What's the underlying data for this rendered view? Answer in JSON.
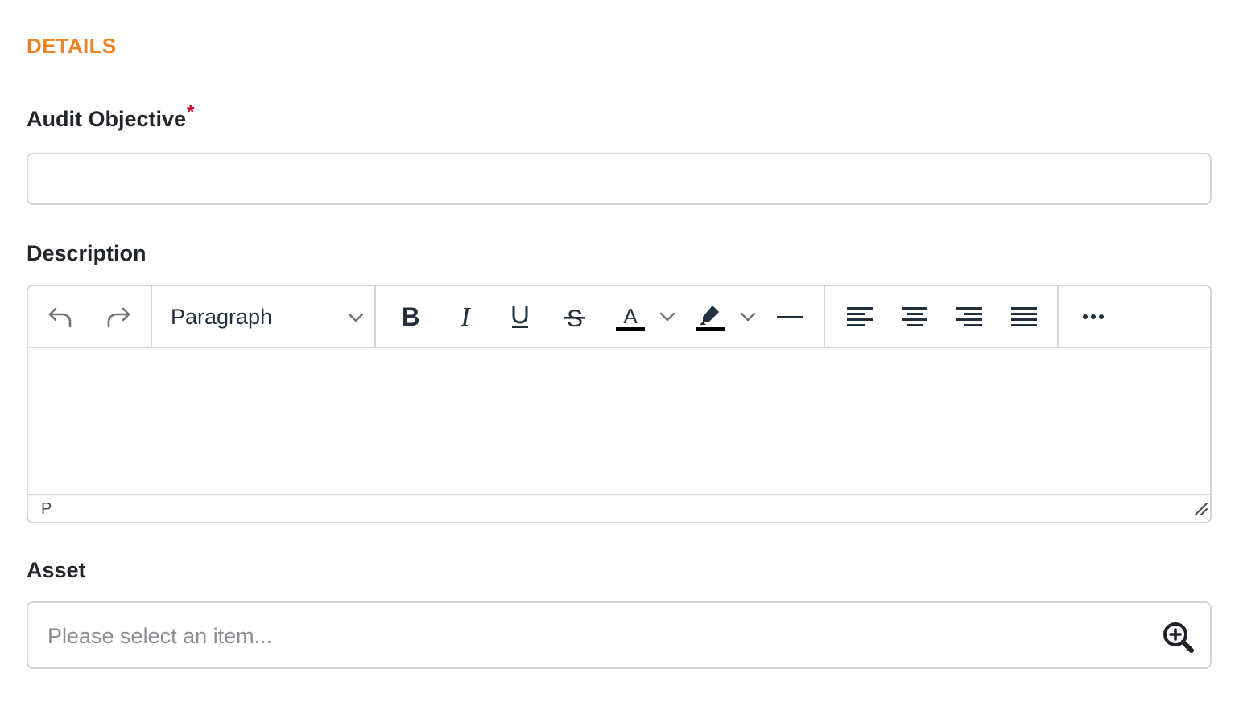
{
  "section": {
    "title": "DETAILS",
    "accent_color": "#ef8222"
  },
  "fields": {
    "audit_objective": {
      "label": "Audit Objective",
      "required_mark": "*",
      "value": ""
    },
    "description": {
      "label": "Description",
      "editor": {
        "toolbar": {
          "undo_icon": "undo-icon",
          "redo_icon": "redo-icon",
          "block_format": "Paragraph",
          "bold_icon": "bold-icon",
          "italic_icon": "italic-icon",
          "underline_icon": "underline-icon",
          "strikethrough_icon": "strikethrough-icon",
          "text_color_icon": "text-color-icon",
          "highlight_icon": "highlight-icon",
          "horizontal_rule_icon": "horizontal-rule-icon",
          "align_left_icon": "align-left-icon",
          "align_center_icon": "align-center-icon",
          "align_right_icon": "align-right-icon",
          "align_justify_icon": "align-justify-icon",
          "more_icon": "more-icon"
        },
        "content": "",
        "status_path": "P"
      }
    },
    "asset": {
      "label": "Asset",
      "placeholder": "Please select an item...",
      "lookup_icon": "zoom-in-icon"
    }
  }
}
